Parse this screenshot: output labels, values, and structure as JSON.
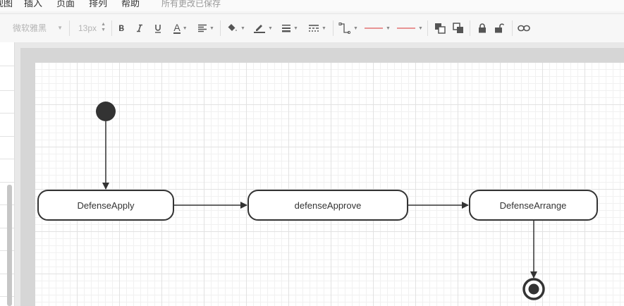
{
  "menu": {
    "items": [
      "视图",
      "插入",
      "页面",
      "排列",
      "帮助"
    ],
    "save_status": "所有更改已保存"
  },
  "toolbar": {
    "font_family": "微软雅黑",
    "font_size": "13px",
    "text_color_label": "A",
    "accent_color": "#e05a5a"
  },
  "diagram": {
    "states": [
      {
        "id": "s1",
        "label": "DefenseApply"
      },
      {
        "id": "s2",
        "label": "defenseApprove"
      },
      {
        "id": "s3",
        "label": "DefenseArrange"
      }
    ],
    "transitions": [
      {
        "from": "initial",
        "to": "s1"
      },
      {
        "from": "s1",
        "to": "s2"
      },
      {
        "from": "s2",
        "to": "s3"
      },
      {
        "from": "s3",
        "to": "final"
      }
    ]
  }
}
